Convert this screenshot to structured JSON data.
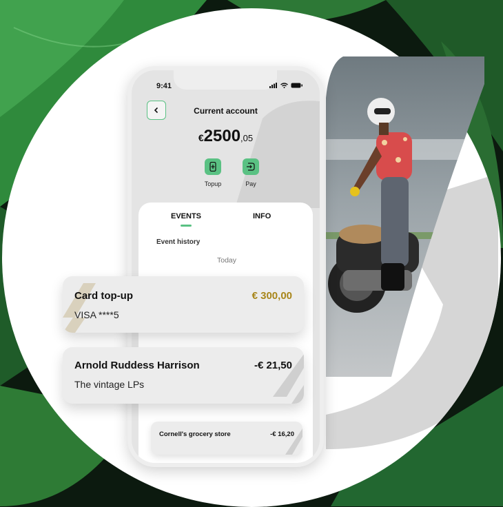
{
  "status": {
    "time": "9:41"
  },
  "header": {
    "title": "Current account"
  },
  "balance": {
    "currency": "€",
    "integer": "2500",
    "decimal": ",05"
  },
  "actions": [
    {
      "label": "Topup",
      "icon": "phone-topup-icon"
    },
    {
      "label": "Pay",
      "icon": "card-pay-icon"
    }
  ],
  "tabs": [
    {
      "label": "EVENTS",
      "active": true
    },
    {
      "label": "INFO",
      "active": false
    }
  ],
  "events": {
    "section_title": "Event history",
    "date_label": "Today",
    "items": [
      {
        "name": "Card top-up",
        "sub": "VISA ****5",
        "amount": "€ 300,00",
        "type": "credit"
      },
      {
        "name": "Arnold Ruddess Harrison",
        "sub": "The vintage LPs",
        "amount": "-€ 21,50",
        "type": "debit"
      },
      {
        "name": "Cornell's grocery store",
        "sub": "",
        "amount": "-€ 16,20",
        "type": "debit"
      }
    ]
  },
  "colors": {
    "accent": "#5ac183",
    "credit": "#a8861a",
    "debit": "#111111",
    "card_bg": "#ececec"
  }
}
